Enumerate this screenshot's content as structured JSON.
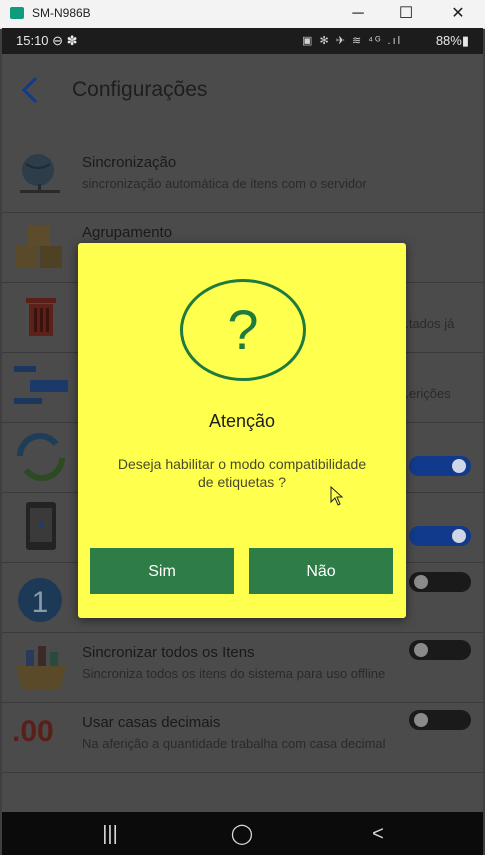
{
  "window": {
    "title": "SM-N986B",
    "minimize": "─",
    "maximize": "☐",
    "close": "✕"
  },
  "status": {
    "time": "15:10 ⊖ ✽",
    "icons": "▣ ✻ ✈ ≋ ⁴ᴳ .ıl",
    "battery": "88%▮"
  },
  "appbar": {
    "back_icon": "chevron-left-icon",
    "title": "Configurações"
  },
  "settings": [
    {
      "title": "Sincronização",
      "subtitle": "sincronização automática de itens com o servidor",
      "icon": "globe-sync-icon",
      "toggle": null
    },
    {
      "title": "Agrupamento",
      "subtitle": "",
      "icon": "boxes-icon",
      "toggle": null
    },
    {
      "title": "",
      "subtitle": "...tados já",
      "icon": "trash-icon",
      "toggle": null
    },
    {
      "title": "",
      "subtitle": "...erições",
      "icon": "tag-list-icon",
      "toggle": null
    },
    {
      "title": "",
      "subtitle": "",
      "icon": "refresh-icon",
      "toggle": "on"
    },
    {
      "title": "",
      "subtitle": "",
      "icon": "phone-scan-icon",
      "toggle": "on"
    },
    {
      "title": "",
      "subtitle": "",
      "icon": "number-one-icon",
      "toggle": "off"
    },
    {
      "title": "Sincronizar todos os Itens",
      "subtitle": "Sincroniza todos os itens do sistema para uso offline",
      "icon": "basket-icon",
      "toggle": "off"
    },
    {
      "title": "Usar casas decimais",
      "subtitle": "Na aferição a quantidade trabalha com casa decimal",
      "icon": "decimal-icon",
      "toggle": "off",
      "icon_text": ".00"
    }
  ],
  "dialog": {
    "icon": "question-icon",
    "symbol": "?",
    "title": "Atenção",
    "message": "Deseja habilitar o modo compatibilidade de etiquetas ?",
    "yes_label": "Sim",
    "no_label": "Não"
  },
  "navbar": {
    "recents": "|||",
    "home": "◯",
    "back": "<"
  },
  "colors": {
    "dialog_bg": "#ffff4d",
    "dialog_button": "#2e7c46",
    "accent": "#1f7a3e",
    "toggle_on": "#123a8c"
  }
}
